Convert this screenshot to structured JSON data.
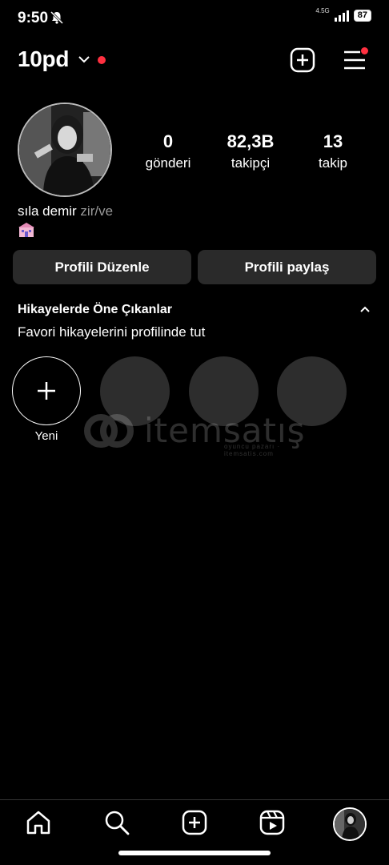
{
  "status_bar": {
    "time": "9:50",
    "network": "4.5G",
    "battery": "87"
  },
  "header": {
    "username": "10pd",
    "icons": [
      "chevron-down-icon",
      "notification-dot",
      "add-icon",
      "menu-icon"
    ]
  },
  "profile": {
    "stats": [
      {
        "value": "0",
        "label": "gönderi"
      },
      {
        "value": "82,3B",
        "label": "takipçi"
      },
      {
        "value": "13",
        "label": "takip"
      }
    ],
    "name": "sıla demir",
    "pronouns": "zir/ve"
  },
  "buttons": {
    "edit": "Profili Düzenle",
    "share": "Profili paylaş"
  },
  "highlights": {
    "title": "Hikayelerde Öne Çıkanlar",
    "subtitle": "Favori hikayelerini profilinde tut",
    "new_label": "Yeni"
  },
  "watermark": {
    "text": "itemsatış",
    "subtext": "oyuncu pazarı · itemsatis.com"
  },
  "colors": {
    "background": "#000000",
    "accent_red": "#ff3040",
    "button_bg": "#2a2a2a"
  }
}
